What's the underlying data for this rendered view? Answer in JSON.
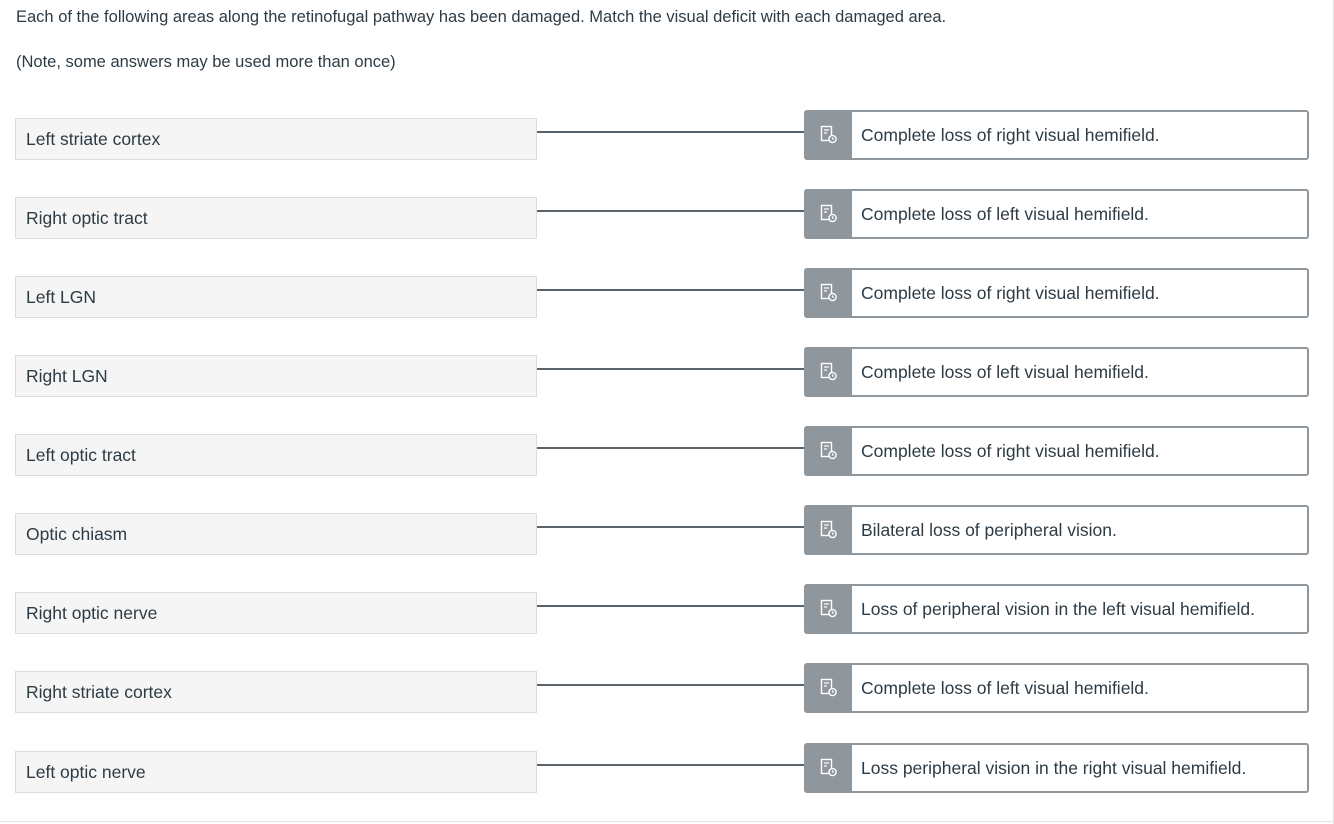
{
  "instructions": {
    "line1": "Each of the following areas along the retinofugal pathway has been damaged. Match the visual deficit with each damaged area.",
    "line2": "(Note, some answers may be used more than once)"
  },
  "handle_icon": "answer-bank-icon",
  "colors": {
    "text": "#2d3b45",
    "left_box_bg": "#f5f5f5",
    "handle_bg": "#8f969c",
    "connector": "#59636b"
  },
  "matches": [
    {
      "area": "Left striate cortex",
      "deficit": "Complete loss of right visual hemifield."
    },
    {
      "area": "Right optic tract",
      "deficit": "Complete loss of left visual hemifield."
    },
    {
      "area": "Left LGN",
      "deficit": "Complete loss of right visual hemifield."
    },
    {
      "area": "Right LGN",
      "deficit": "Complete loss of left visual hemifield."
    },
    {
      "area": "Left optic tract",
      "deficit": "Complete loss of right visual hemifield."
    },
    {
      "area": "Optic chiasm",
      "deficit": "Bilateral loss of peripheral vision."
    },
    {
      "area": "Right optic nerve",
      "deficit": "Loss of peripheral vision in the left visual hemifield."
    },
    {
      "area": "Right striate cortex",
      "deficit": "Complete loss of left visual hemifield."
    },
    {
      "area": "Left optic nerve",
      "deficit": "Loss peripheral vision in the right visual hemifield."
    }
  ]
}
